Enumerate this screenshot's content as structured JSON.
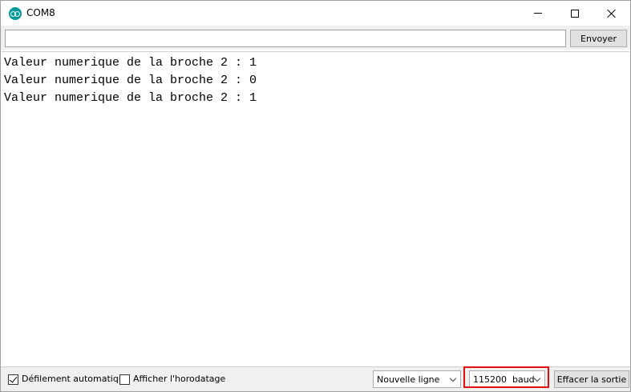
{
  "window": {
    "title": "COM8"
  },
  "input": {
    "value": "",
    "placeholder": ""
  },
  "toolbar": {
    "send_label": "Envoyer"
  },
  "output": {
    "lines": [
      "Valeur numerique de la broche 2 : 1",
      "Valeur numerique de la broche 2 : 0",
      "Valeur numerique de la broche 2 : 1"
    ]
  },
  "bottom": {
    "autoscroll_label": "Défilement automatique",
    "autoscroll_checked": true,
    "timestamp_label": "Afficher l'horodatage",
    "timestamp_checked": false,
    "line_ending": "Nouvelle ligne",
    "baud_rate": "115200  baud",
    "clear_label": "Effacer la sortie"
  },
  "colors": {
    "app_icon": "#00979c",
    "highlight": "#e01010"
  }
}
